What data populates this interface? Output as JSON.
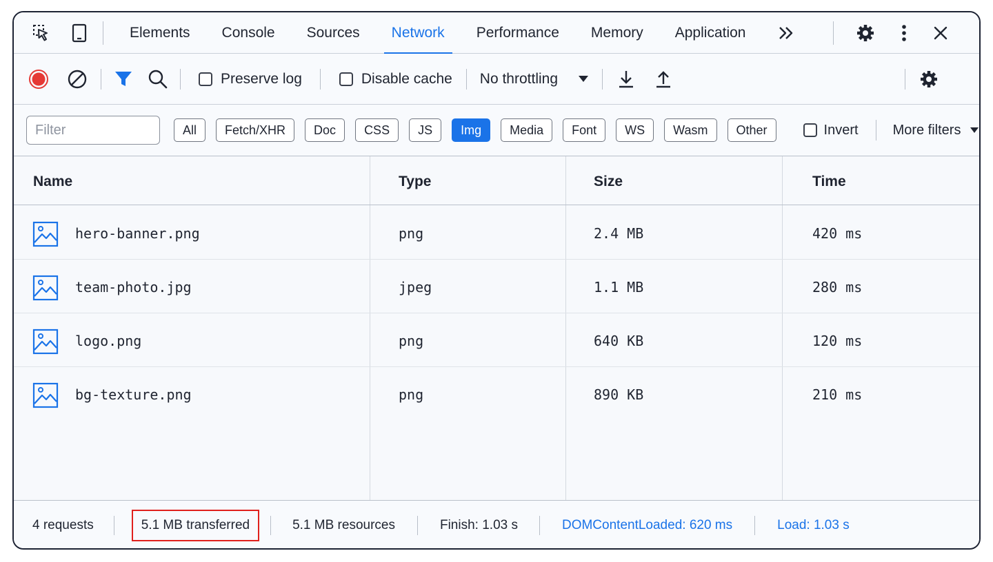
{
  "tabs": [
    {
      "label": "Elements",
      "active": false
    },
    {
      "label": "Console",
      "active": false
    },
    {
      "label": "Sources",
      "active": false
    },
    {
      "label": "Network",
      "active": true
    },
    {
      "label": "Performance",
      "active": false
    },
    {
      "label": "Memory",
      "active": false
    },
    {
      "label": "Application",
      "active": false
    }
  ],
  "toolbar": {
    "preserve_log": "Preserve log",
    "disable_cache": "Disable cache",
    "throttling": "No throttling"
  },
  "filterbar": {
    "placeholder": "Filter",
    "chips": [
      "All",
      "Fetch/XHR",
      "Doc",
      "CSS",
      "JS",
      "Img",
      "Media",
      "Font",
      "WS",
      "Wasm",
      "Other"
    ],
    "active_chip": "Img",
    "invert": "Invert",
    "more_filters": "More filters"
  },
  "table": {
    "headers": [
      "Name",
      "Type",
      "Size",
      "Time"
    ],
    "rows": [
      {
        "name": "hero-banner.png",
        "type": "png",
        "size": "2.4 MB",
        "time": "420 ms"
      },
      {
        "name": "team-photo.jpg",
        "type": "jpeg",
        "size": "1.1 MB",
        "time": "280 ms"
      },
      {
        "name": "logo.png",
        "type": "png",
        "size": "640 KB",
        "time": "120 ms"
      },
      {
        "name": "bg-texture.png",
        "type": "png",
        "size": "890 KB",
        "time": "210 ms"
      }
    ]
  },
  "status": {
    "requests": "4 requests",
    "transferred": "5.1 MB transferred",
    "resources": "5.1 MB resources",
    "finish": "Finish: 1.03 s",
    "dom_content_loaded": "DOMContentLoaded: 620 ms",
    "load": "Load: 1.03 s"
  },
  "colors": {
    "accent": "#1a73e8",
    "record": "#e53935",
    "highlight_box": "#e0201c"
  },
  "icons": [
    "select-element-icon",
    "device-toolbar-icon",
    "more-tabs-icon",
    "settings-icon",
    "kebab-menu-icon",
    "close-icon",
    "record-icon",
    "clear-icon",
    "filter-icon",
    "search-icon",
    "import-har-icon",
    "export-har-icon",
    "network-settings-icon",
    "image-file-icon"
  ]
}
